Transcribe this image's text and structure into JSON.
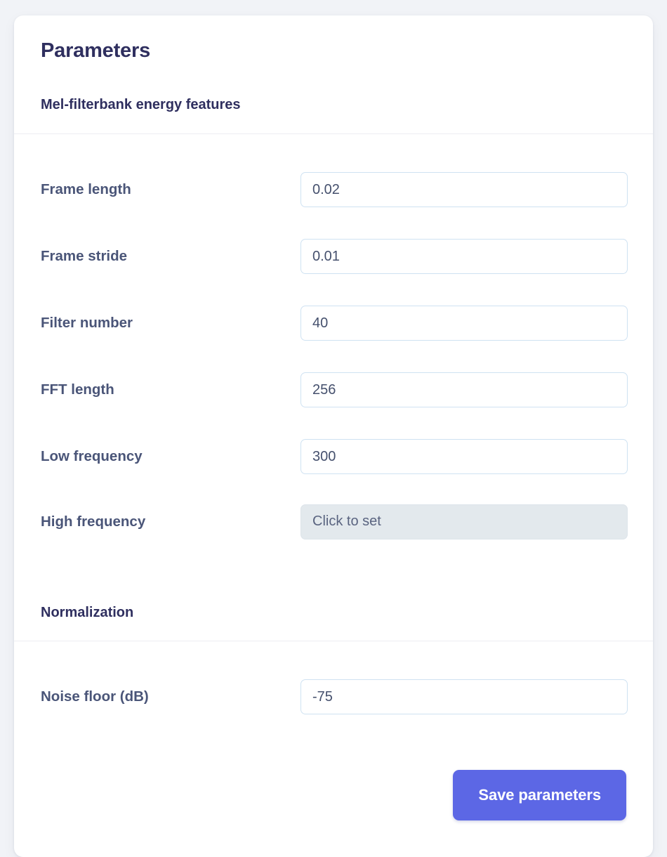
{
  "card": {
    "title": "Parameters",
    "sections": [
      {
        "name": "mel-filterbank",
        "heading": "Mel-filterbank energy features",
        "fields": [
          {
            "label": "Frame length",
            "value": "0.02",
            "type": "text",
            "placeholder": ""
          },
          {
            "label": "Frame stride",
            "value": "0.01",
            "type": "text",
            "placeholder": ""
          },
          {
            "label": "Filter number",
            "value": "40",
            "type": "text",
            "placeholder": ""
          },
          {
            "label": "FFT length",
            "value": "256",
            "type": "text",
            "placeholder": ""
          },
          {
            "label": "Low frequency",
            "value": "300",
            "type": "text",
            "placeholder": ""
          },
          {
            "label": "High frequency",
            "value": "Click to set",
            "type": "placeholder-button",
            "placeholder": "Click to set"
          }
        ]
      },
      {
        "name": "normalization",
        "heading": "Normalization",
        "fields": [
          {
            "label": "Noise floor (dB)",
            "value": "-75",
            "type": "text",
            "placeholder": ""
          }
        ]
      }
    ],
    "footer": {
      "save_label": "Save parameters"
    }
  },
  "colors": {
    "page_background": "#f1f3f7",
    "card_background": "#ffffff",
    "heading_text": "#2f2f5f",
    "label_text": "#4a5578",
    "input_border": "#cfe2f2",
    "input_text": "#45506d",
    "disabled_field_background": "#e3e9ed",
    "primary_button": "#5c67e5",
    "divider": "#edeef2"
  }
}
